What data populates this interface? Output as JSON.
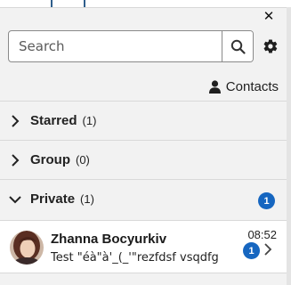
{
  "header": {
    "close_label": "✕"
  },
  "search": {
    "placeholder": "Search",
    "value": ""
  },
  "contacts": {
    "label": "Contacts"
  },
  "sections": [
    {
      "name": "Starred",
      "count": "(1)",
      "expanded": false,
      "badge": ""
    },
    {
      "name": "Group",
      "count": "(0)",
      "expanded": false,
      "badge": ""
    },
    {
      "name": "Private",
      "count": "(1)",
      "expanded": true,
      "badge": "1"
    }
  ],
  "conversation": {
    "name": "Zhanna Bocyurkiv",
    "message": "Test \"éà\"à'_(_'\"rezfdsf vsqdfg",
    "time": "08:52",
    "unread": "1"
  },
  "colors": {
    "accent": "#1666c0",
    "panel_bg": "#f2f2f2",
    "tab_border": "#2f5e8c"
  },
  "icons": [
    "close-icon",
    "search-icon",
    "gear-icon",
    "user-icon",
    "chevron-right-icon",
    "chevron-down-icon"
  ]
}
